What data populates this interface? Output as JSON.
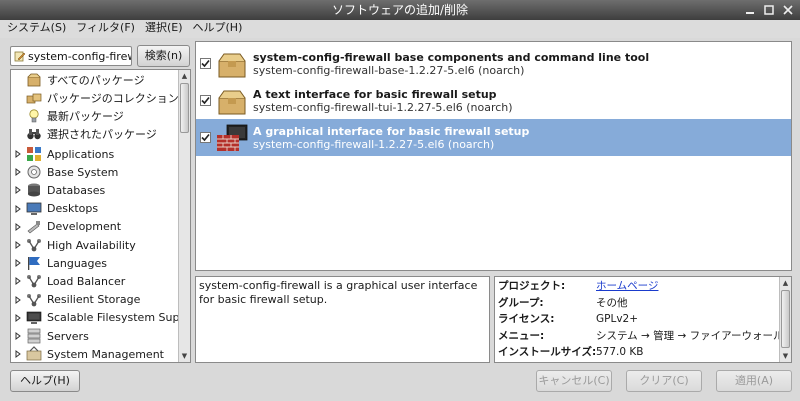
{
  "window": {
    "title": "ソフトウェアの追加/削除"
  },
  "menu": [
    "システム(S)",
    "フィルタ(F)",
    "選択(E)",
    "ヘルプ(H)"
  ],
  "search": {
    "value": "system-config-firewall",
    "button_label": "検索(n)"
  },
  "left_top_items": [
    {
      "label": "すべてのパッケージ",
      "icon": "package-icon"
    },
    {
      "label": "パッケージのコレクション",
      "icon": "collection-icon"
    },
    {
      "label": "最新パッケージ",
      "icon": "lightbulb-icon"
    },
    {
      "label": "選択されたパッケージ",
      "icon": "binoculars-icon"
    }
  ],
  "groups": [
    {
      "label": "Applications",
      "icon": "applications-icon"
    },
    {
      "label": "Base System",
      "icon": "base-system-icon"
    },
    {
      "label": "Databases",
      "icon": "database-icon"
    },
    {
      "label": "Desktops",
      "icon": "desktop-icon"
    },
    {
      "label": "Development",
      "icon": "development-icon"
    },
    {
      "label": "High Availability",
      "icon": "network-icon"
    },
    {
      "label": "Languages",
      "icon": "flag-icon"
    },
    {
      "label": "Load Balancer",
      "icon": "network-icon"
    },
    {
      "label": "Resilient Storage",
      "icon": "network-icon"
    },
    {
      "label": "Scalable Filesystem Support",
      "icon": "monitor-icon"
    },
    {
      "label": "Servers",
      "icon": "server-icon"
    },
    {
      "label": "System Management",
      "icon": "management-icon"
    }
  ],
  "packages": [
    {
      "summary": "system-config-firewall base components and command line tool",
      "name": "system-config-firewall-base-1.2.27-5.el6 (noarch)",
      "checked": true,
      "selected": false,
      "icon": "box-icon"
    },
    {
      "summary": "A text interface for basic firewall setup",
      "name": "system-config-firewall-tui-1.2.27-5.el6 (noarch)",
      "checked": true,
      "selected": false,
      "icon": "box-icon"
    },
    {
      "summary": "A graphical interface for basic firewall setup",
      "name": "system-config-firewall-1.2.27-5.el6 (noarch)",
      "checked": true,
      "selected": true,
      "icon": "firewall-icon"
    }
  ],
  "description": "system-config-firewall is a graphical user interface for basic firewall setup.",
  "details": [
    {
      "key": "プロジェクト:",
      "value": "ホームページ",
      "link": true
    },
    {
      "key": "グループ:",
      "value": "その他",
      "link": false
    },
    {
      "key": "ライセンス:",
      "value": "GPLv2+",
      "link": false
    },
    {
      "key": "メニュー:",
      "value": "システム → 管理 → ファイアーウォール",
      "link": false
    },
    {
      "key": "インストールサイズ:",
      "value": "577.0 KB",
      "link": false
    }
  ],
  "buttons": {
    "help": "ヘルプ(H)",
    "cancel": "キャンセル(C)",
    "clear": "クリア(C)",
    "apply": "適用(A)"
  },
  "colors": {
    "selection": "#86abd9",
    "link": "#1a3bcc"
  }
}
